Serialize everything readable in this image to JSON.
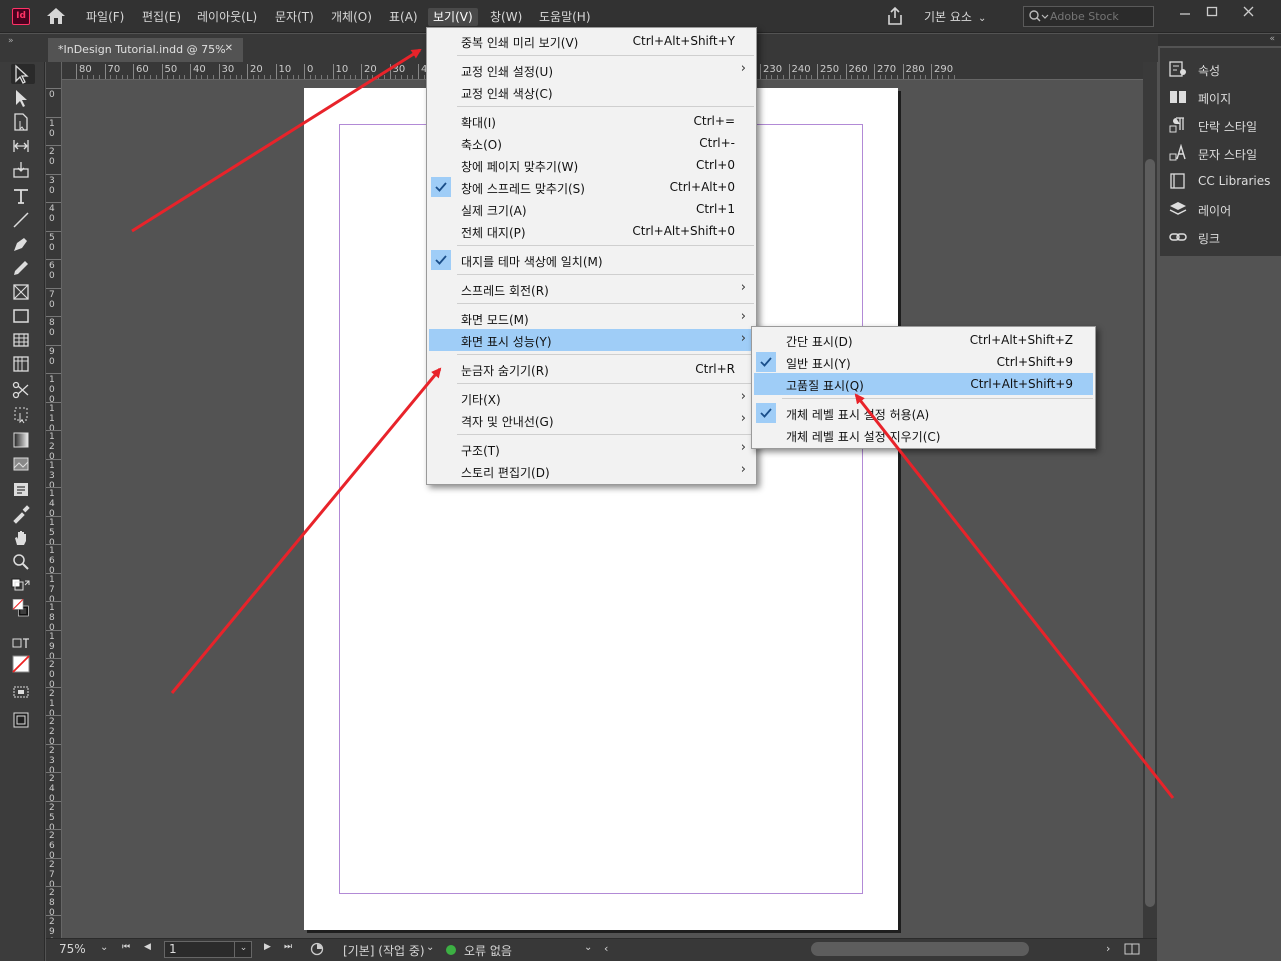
{
  "app": {
    "logo_text": "Id"
  },
  "menubar": {
    "items": [
      "파일(F)",
      "편집(E)",
      "레이아웃(L)",
      "문자(T)",
      "개체(O)",
      "표(A)",
      "보기(V)",
      "창(W)",
      "도움말(H)"
    ],
    "workspace": "기본 요소",
    "search_placeholder": "Adobe Stock"
  },
  "document": {
    "tab_title": "*InDesign Tutorial.indd @ 75%"
  },
  "rulers": {
    "top_labels": [
      "80",
      "70",
      "60",
      "50",
      "40",
      "30",
      "20",
      "10",
      "0",
      "10",
      "20",
      "30",
      "40",
      "160",
      "170",
      "180",
      "190",
      "200",
      "210",
      "220",
      "230",
      "240",
      "250",
      "260",
      "270",
      "280",
      "290"
    ],
    "left_labels": [
      "0",
      "10",
      "20",
      "30",
      "40",
      "50",
      "60",
      "70",
      "80",
      "90",
      "100",
      "110",
      "120",
      "130",
      "140",
      "150",
      "160",
      "170",
      "180",
      "190",
      "200",
      "210",
      "220",
      "230",
      "240",
      "250",
      "260",
      "270",
      "280",
      "290"
    ]
  },
  "view_menu": {
    "items": [
      {
        "label": "중복 인쇄 미리 보기(V)",
        "shortcut": "Ctrl+Alt+Shift+Y"
      },
      {
        "label": "교정 인쇄 설정(U)",
        "submenu": true
      },
      {
        "label": "교정 인쇄 색상(C)"
      },
      {
        "label": "확대(I)",
        "shortcut": "Ctrl+="
      },
      {
        "label": "축소(O)",
        "shortcut": "Ctrl+-"
      },
      {
        "label": "창에 페이지 맞추기(W)",
        "shortcut": "Ctrl+0"
      },
      {
        "label": "창에 스프레드 맞추기(S)",
        "shortcut": "Ctrl+Alt+0",
        "checked": true
      },
      {
        "label": "실제 크기(A)",
        "shortcut": "Ctrl+1"
      },
      {
        "label": "전체 대지(P)",
        "shortcut": "Ctrl+Alt+Shift+0"
      },
      {
        "label": "대지를 테마 색상에 일치(M)",
        "checked": true
      },
      {
        "label": "스프레드 회전(R)",
        "submenu": true
      },
      {
        "label": "화면 모드(M)",
        "submenu": true
      },
      {
        "label": "화면 표시 성능(Y)",
        "submenu": true,
        "highlighted": true
      },
      {
        "label": "눈금자 숨기기(R)",
        "shortcut": "Ctrl+R"
      },
      {
        "label": "기타(X)",
        "submenu": true
      },
      {
        "label": "격자 및 안내선(G)",
        "submenu": true
      },
      {
        "label": "구조(T)",
        "submenu": true
      },
      {
        "label": "스토리 편집기(D)",
        "submenu": true
      }
    ]
  },
  "display_submenu": {
    "items": [
      {
        "label": "간단 표시(D)",
        "shortcut": "Ctrl+Alt+Shift+Z"
      },
      {
        "label": "일반 표시(Y)",
        "shortcut": "Ctrl+Shift+9",
        "checked": true
      },
      {
        "label": "고품질 표시(Q)",
        "shortcut": "Ctrl+Alt+Shift+9",
        "highlighted": true
      },
      {
        "label": "개체 레벨 표시 설정 허용(A)",
        "checked": true
      },
      {
        "label": "개체 레벨 표시 설정 지우기(C)"
      }
    ]
  },
  "right_panel": {
    "items": [
      {
        "label": "속성",
        "icon": "properties-icon"
      },
      {
        "label": "페이지",
        "icon": "pages-icon"
      },
      {
        "label": "단락 스타일",
        "icon": "paragraph-styles-icon"
      },
      {
        "label": "문자 스타일",
        "icon": "character-styles-icon"
      },
      {
        "label": "CC Libraries",
        "icon": "cc-libraries-icon"
      },
      {
        "label": "레이어",
        "icon": "layers-icon"
      },
      {
        "label": "링크",
        "icon": "links-icon"
      }
    ]
  },
  "statusbar": {
    "zoom": "75%",
    "page": "1",
    "style": "[기본] (작업 중)",
    "preflight": "오류 없음"
  },
  "colors": {
    "highlight": "#9fcdf7",
    "arrow": "#e8232a",
    "preflight_ok": "#3cb043",
    "logo": "#ff3366"
  }
}
